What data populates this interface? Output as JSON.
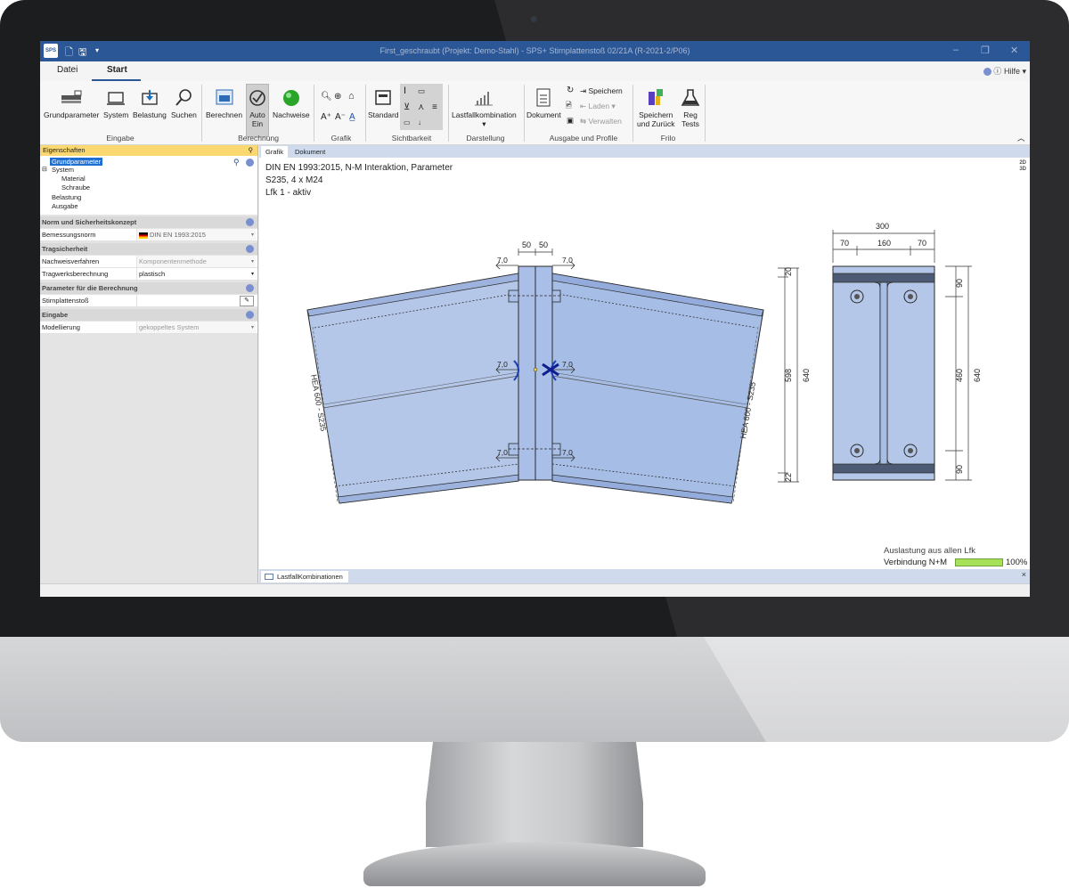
{
  "app": {
    "logo_text": "SPS",
    "title": "First_geschraubt (Projekt: Demo-Stahl) - SPS+ Stirnplattenstoß 02/21A (R-2021-2/P06)",
    "window_controls": [
      "–",
      "❐",
      "✕"
    ]
  },
  "menu": {
    "tabs": [
      "Datei",
      "Start"
    ],
    "help": "Hilfe"
  },
  "ribbon": {
    "eingabe": {
      "buttons": [
        "Grundparameter",
        "System",
        "Belastung",
        "Suchen"
      ],
      "label": "Eingabe"
    },
    "berechnung": {
      "buttons": [
        "Berechnen",
        "Auto",
        "Ein",
        "Nachweise"
      ],
      "label": "Berechnung"
    },
    "grafik": {
      "label": "Grafik"
    },
    "sichtbarkeit": {
      "standard": "Standard",
      "label": "Sichtbarkeit"
    },
    "darstellung": {
      "button": "Lastfallkombination",
      "label": "Darstellung"
    },
    "ausgabe": {
      "dokument": "Dokument",
      "speichern": "Speichern",
      "laden": "Laden",
      "verwalten": "Verwalten",
      "label": "Ausgabe und Profile"
    },
    "frilo": {
      "speichern": "Speichern",
      "zurueck": "und Zurück",
      "reg": "Reg",
      "tests": "Tests",
      "label": "Frilo"
    }
  },
  "left_panel": {
    "header": "Eigenschaften",
    "tree": [
      "Grundparameter",
      "System",
      "Material",
      "Schraube",
      "Belastung",
      "Ausgabe"
    ],
    "sections": {
      "norm": "Norm und Sicherheitskonzept",
      "trag": "Tragsicherheit",
      "param": "Parameter für die Berechnung",
      "eingabe": "Eingabe"
    },
    "props": {
      "bemessungsnorm": {
        "key": "Bemessungsnorm",
        "value": "DIN EN 1993:2015"
      },
      "nachweisverfahren": {
        "key": "Nachweisverfahren",
        "value": "Komponentenmethode"
      },
      "tragwerksberechnung": {
        "key": "Tragwerksberechnung",
        "value": "plastisch"
      },
      "stirnplattenstoss": {
        "key": "Stirnplattenstoß",
        "value": ""
      },
      "modellierung": {
        "key": "Modellierung",
        "value": "gekoppeltes System"
      }
    }
  },
  "main": {
    "tabs": [
      "Grafik",
      "Dokument"
    ],
    "view_badge": [
      "2D",
      "3D"
    ],
    "info": [
      "DIN EN 1993:2015,  N-M Interaktion,  Parameter",
      "S235,  4 x M24",
      "Lfk 1 - aktiv"
    ],
    "drawing": {
      "profile_label": "HEA 600 - S235",
      "weld": "7,0",
      "plate_dims": [
        "50",
        "50"
      ],
      "section_width": "300",
      "section_parts": [
        "70",
        "160",
        "70"
      ],
      "left_dims": [
        "20",
        "598",
        "22",
        "640"
      ],
      "right_dims": [
        "90",
        "460",
        "90",
        "640"
      ]
    },
    "utilization": {
      "title": "Auslastung aus allen Lfk",
      "label": "Verbindung N+M",
      "percent": "100%",
      "ratio": 1.0
    },
    "bottom_tab": "LastfallKombinationen",
    "close": "×"
  }
}
